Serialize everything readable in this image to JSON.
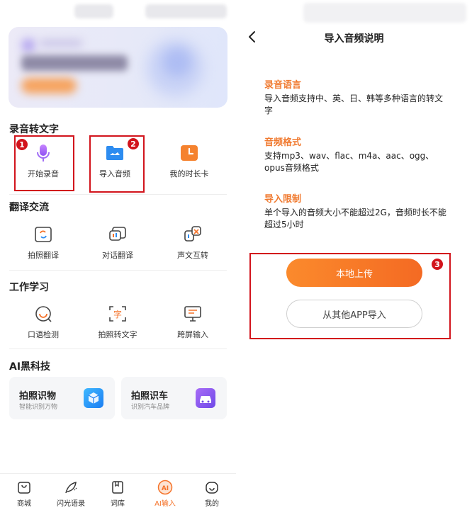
{
  "left": {
    "sections": {
      "recording": "录音转文字",
      "translate": "翻译交流",
      "work": "工作学习",
      "ai": "AI黑科技"
    },
    "recording_items": [
      "开始录音",
      "导入音频",
      "我的时长卡"
    ],
    "translate_items": [
      "拍照翻译",
      "对话翻译",
      "声文互转"
    ],
    "work_items": [
      "口语检测",
      "拍照转文字",
      "跨屏输入"
    ],
    "ai_cards": [
      {
        "title": "拍照识物",
        "subtitle": "智能识别万物"
      },
      {
        "title": "拍照识车",
        "subtitle": "识别汽车品牌"
      }
    ],
    "badges": [
      "1",
      "2"
    ],
    "nav": [
      "商城",
      "闪光语录",
      "词库",
      "AI输入",
      "我的"
    ],
    "nav_active_icon": "AI"
  },
  "right": {
    "title": "导入音频说明",
    "blocks": [
      {
        "heading": "录音语言",
        "text": "导入音频支持中、英、日、韩等多种语言的转文字"
      },
      {
        "heading": "音频格式",
        "text": "支持mp3、wav、flac、m4a、aac、ogg、opus音频格式"
      },
      {
        "heading": "导入限制",
        "text": "单个导入的音频大小不能超过2G，音频时长不能超过5小时"
      }
    ],
    "upload_label": "本地上传",
    "import_label": "从其他APP导入",
    "badge": "3"
  },
  "colors": {
    "accent": "#f07a30",
    "annotation_red": "#d2141c"
  }
}
